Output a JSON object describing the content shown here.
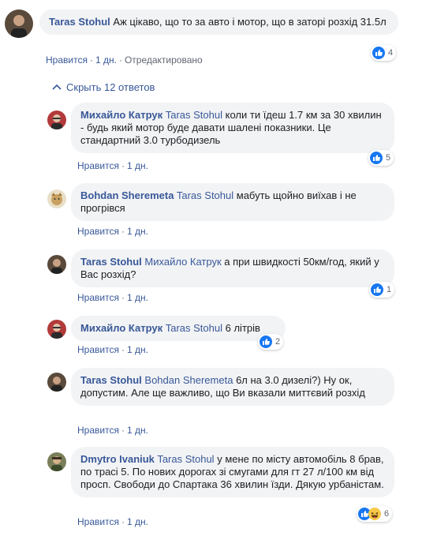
{
  "colors": {
    "link": "#385898",
    "bubble_bg": "#f2f3f5",
    "meta_text": "#606770",
    "like_blue": "#1877f2",
    "haha_yellow": "#f7c84a"
  },
  "actions": {
    "like": "Нравится",
    "age": "1 дн.",
    "edited": "Отредактировано",
    "hide_replies": "Скрыть 12 ответов"
  },
  "comments": [
    {
      "author": "Taras Stohul",
      "tag": "",
      "text": "Аж цікаво, що то за авто і мотор, що в заторі розхід 31.5л",
      "likes": "4",
      "avatar_icon": "avatar-taras-icon"
    },
    {
      "author": "Михайло Катрук",
      "tag": "Taras Stohul",
      "text": "коли ти їдеш 1.7 км за 30 хвилин - будь який мотор буде давати шалені показники. Це стандартний 3.0 турбодизель",
      "likes": "5",
      "avatar_icon": "avatar-mykhailo-icon"
    },
    {
      "author": "Bohdan Sheremeta",
      "tag": "Taras Stohul",
      "text": "мабуть щойно виїхав і не прогрівся",
      "likes": "",
      "avatar_icon": "avatar-bohdan-icon"
    },
    {
      "author": "Taras Stohul",
      "tag": "Михайло Катрук",
      "text": "а при швидкості 50км/год, який у Вас розхід?",
      "likes": "1",
      "avatar_icon": "avatar-taras-icon"
    },
    {
      "author": "Михайло Катрук",
      "tag": "Taras Stohul",
      "text": "6 літрів",
      "likes": "2",
      "avatar_icon": "avatar-mykhailo-icon"
    },
    {
      "author": "Taras Stohul",
      "tag": "Bohdan Sheremeta",
      "text": "6л на 3.0 дизелі?) Ну ок, допустим. Але ще важливо, що Ви вказали миттєвий розхід",
      "likes": "",
      "avatar_icon": "avatar-taras-icon"
    },
    {
      "author": "Dmytro Ivaniuk",
      "tag": "Taras Stohul",
      "text": "у мене по місту автомобіль 8 брав, по трасі 5. По нових дорогах зі смугами для гт 27 л/100 км від просп. Свободи до Спартака 36 хвилин їзди. Дякую урбаністам.",
      "likes": "6",
      "avatar_icon": "avatar-dmytro-icon"
    }
  ]
}
